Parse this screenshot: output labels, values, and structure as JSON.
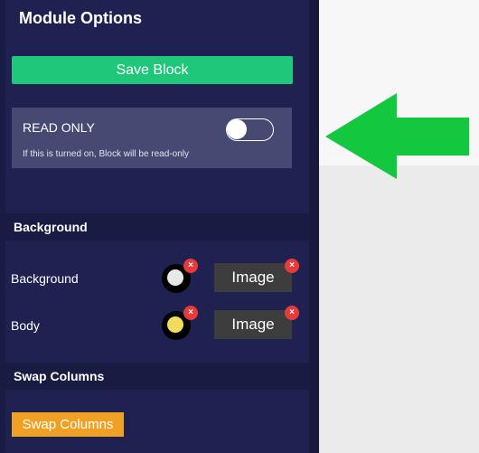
{
  "panel": {
    "title": "Module Options",
    "save_label": "Save Block",
    "read_only": {
      "label": "READ ONLY",
      "help": "If this is turned on, Block will be read-only",
      "enabled": false
    },
    "background_section": {
      "header": "Background",
      "rows": [
        {
          "label": "Background",
          "color": "#e8e8e8",
          "image_label": "Image",
          "remove_glyph": "×"
        },
        {
          "label": "Body",
          "color": "#f2dc5d",
          "image_label": "Image",
          "remove_glyph": "×"
        }
      ]
    },
    "swap_section": {
      "header": "Swap Columns",
      "button_label": "Swap Columns"
    }
  },
  "colors": {
    "panel_bg": "#1f2251",
    "save_button": "#1fc77a",
    "swap_button": "#f0a023",
    "remove_badge": "#e53b3b",
    "arrow": "#13c83f"
  },
  "icons": [
    "toggle-switch",
    "color-swatch",
    "remove-icon",
    "green-arrow-left-icon"
  ]
}
